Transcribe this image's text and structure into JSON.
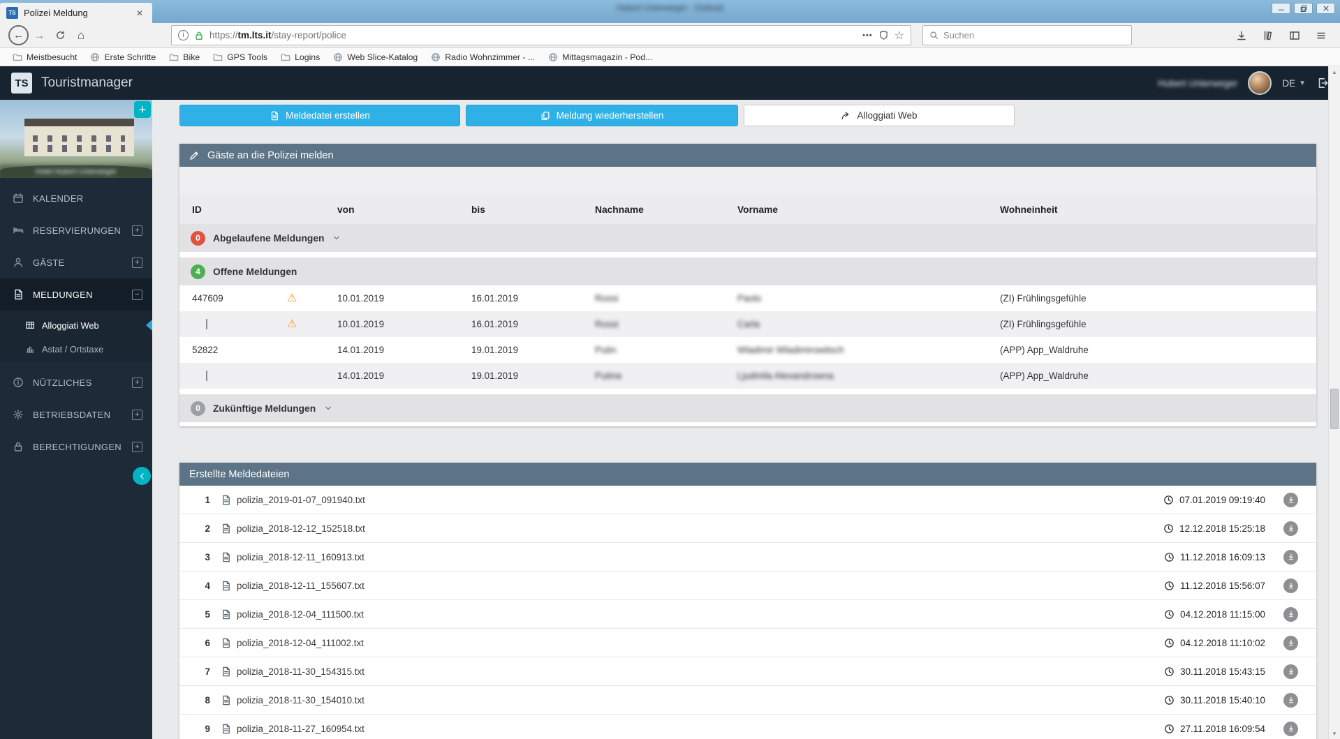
{
  "window_title": "Hubert Unterweger - Outlook",
  "browser": {
    "tab_title": "Polizei Meldung",
    "url": {
      "scheme": "https://",
      "domain": "tm.lts.it",
      "path": "/stay-report/police"
    },
    "page_actions": "•••",
    "search_placeholder": "Suchen",
    "bookmarks": [
      "Meistbesucht",
      "Erste Schritte",
      "Bike",
      "GPS Tools",
      "Logins",
      "Web Slice-Katalog",
      "Radio Wohnzimmer - ...",
      "Mittagsmagazin - Pod..."
    ]
  },
  "header": {
    "logo": "TS",
    "brand": "Touristmanager",
    "user": "Hubert Unterweger",
    "language": "DE"
  },
  "sidebar": {
    "photo_caption": "Hotel Hubert Unterweger",
    "items": [
      {
        "label": "KALENDER"
      },
      {
        "label": "RESERVIERUNGEN"
      },
      {
        "label": "GÄSTE"
      },
      {
        "label": "MELDUNGEN"
      },
      {
        "label": "NÜTZLICHES"
      },
      {
        "label": "BETRIEBSDATEN"
      },
      {
        "label": "BERECHTIGUNGEN"
      }
    ],
    "subitems": [
      {
        "label": "Alloggiati Web"
      },
      {
        "label": "Astat / Ortstaxe"
      }
    ]
  },
  "actions": {
    "create_file": "Meldedatei erstellen",
    "restore_report": "Meldung wiederherstellen",
    "alloggiati_web": "Alloggiati Web"
  },
  "report_panel": {
    "title": "Gäste an die Polizei melden",
    "columns": [
      "ID",
      "von",
      "bis",
      "Nachname",
      "Vorname",
      "Wohneinheit"
    ],
    "groups": {
      "expired": {
        "count": "0",
        "label": "Abgelaufene Meldungen"
      },
      "open": {
        "count": "4",
        "label": "Offene Meldungen"
      },
      "future": {
        "count": "0",
        "label": "Zukünftige Meldungen"
      }
    },
    "rows": [
      {
        "id": "447609",
        "from": "10.01.2019",
        "to": "16.01.2019",
        "lastname": "Rossi",
        "firstname": "Paolo",
        "unit": "(ZI) Frühlingsgefühle"
      },
      {
        "id": "",
        "from": "10.01.2019",
        "to": "16.01.2019",
        "lastname": "Rossi",
        "firstname": "Carla",
        "unit": "(ZI) Frühlingsgefühle"
      },
      {
        "id": "52822",
        "from": "14.01.2019",
        "to": "19.01.2019",
        "lastname": "Putin",
        "firstname": "Wladimir Wladimirowitsch",
        "unit": "(APP) App_Waldruhe"
      },
      {
        "id": "",
        "from": "14.01.2019",
        "to": "19.01.2019",
        "lastname": "Putina",
        "firstname": "Ljudmila Alexandrowna",
        "unit": "(APP) App_Waldruhe"
      }
    ]
  },
  "files_panel": {
    "title": "Erstellte Meldedateien",
    "files": [
      {
        "num": "1",
        "name": "polizia_2019-01-07_091940.txt",
        "time": "07.01.2019 09:19:40"
      },
      {
        "num": "2",
        "name": "polizia_2018-12-12_152518.txt",
        "time": "12.12.2018 15:25:18"
      },
      {
        "num": "3",
        "name": "polizia_2018-12-11_160913.txt",
        "time": "11.12.2018 16:09:13"
      },
      {
        "num": "4",
        "name": "polizia_2018-12-11_155607.txt",
        "time": "11.12.2018 15:56:07"
      },
      {
        "num": "5",
        "name": "polizia_2018-12-04_111500.txt",
        "time": "04.12.2018 11:15:00"
      },
      {
        "num": "6",
        "name": "polizia_2018-12-04_111002.txt",
        "time": "04.12.2018 11:10:02"
      },
      {
        "num": "7",
        "name": "polizia_2018-11-30_154315.txt",
        "time": "30.11.2018 15:43:15"
      },
      {
        "num": "8",
        "name": "polizia_2018-11-30_154010.txt",
        "time": "30.11.2018 15:40:10"
      },
      {
        "num": "9",
        "name": "polizia_2018-11-27_160954.txt",
        "time": "27.11.2018 16:09:54"
      }
    ]
  },
  "colors": {
    "accent_teal": "#00b4c6",
    "button_blue": "#2fb1e8",
    "panel_header": "#5d7487",
    "badge_red": "#df5340",
    "badge_green": "#4caf50",
    "badge_gray": "#9aa0a6",
    "warning_orange": "#f0a032",
    "lock_green": "#28a745",
    "titlebar_blue": "#7fb0d4"
  }
}
